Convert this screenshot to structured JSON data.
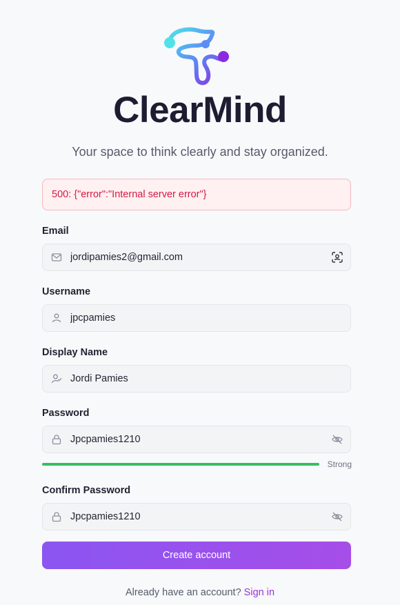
{
  "brand": {
    "name": "ClearMind",
    "tagline": "Your space to think clearly and stay organized."
  },
  "error": {
    "message": "500: {\"error\":\"Internal server error\"}"
  },
  "form": {
    "email": {
      "label": "Email",
      "value": "jordipamies2@gmail.com",
      "icon": "mail-icon",
      "trail_icon": "contact-scan-icon"
    },
    "username": {
      "label": "Username",
      "value": "jpcpamies",
      "icon": "user-icon"
    },
    "display_name": {
      "label": "Display Name",
      "value": "Jordi Pamies",
      "icon": "user-check-icon"
    },
    "password": {
      "label": "Password",
      "value": "Jpcpamies1210",
      "icon": "lock-icon",
      "trail_icon": "eye-off-icon"
    },
    "strength": {
      "label": "Strong",
      "level": 1.0,
      "color": "#34c063"
    },
    "confirm_password": {
      "label": "Confirm Password",
      "value": "Jpcpamies1210",
      "icon": "lock-icon",
      "trail_icon": "eye-off-icon"
    },
    "submit_label": "Create account"
  },
  "footer": {
    "prompt": "Already have an account?",
    "link": "Sign in"
  },
  "colors": {
    "accent": "#9b32d8",
    "error_text": "#d11a45",
    "error_bg": "#fff0f1",
    "button_start": "#8b55f2",
    "button_end": "#a64ee8"
  }
}
